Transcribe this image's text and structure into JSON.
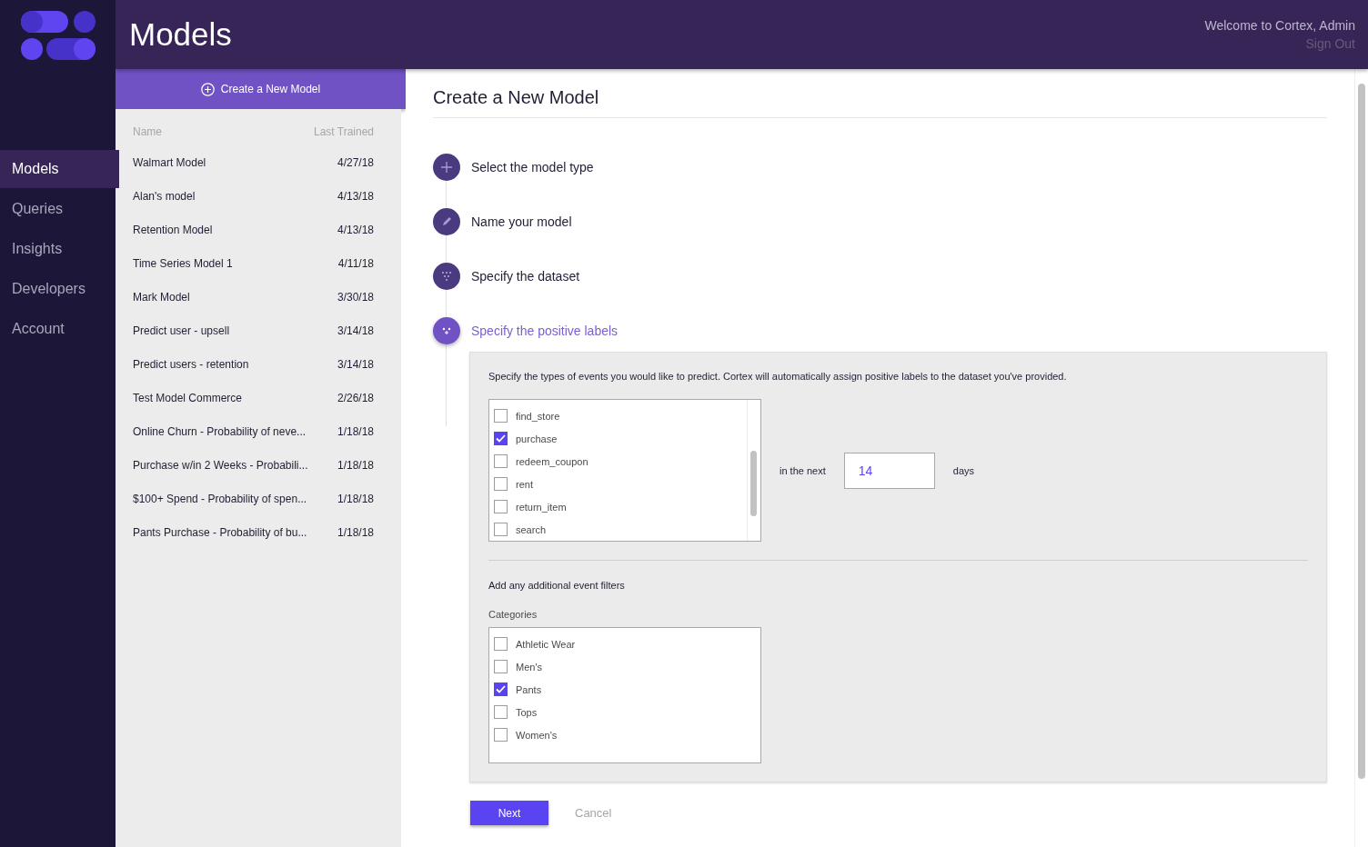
{
  "header": {
    "title": "Models",
    "welcome": "Welcome to Cortex, Admin",
    "sign_out": "Sign Out"
  },
  "nav": [
    {
      "label": "Models",
      "selected": true
    },
    {
      "label": "Queries",
      "selected": false
    },
    {
      "label": "Insights",
      "selected": false
    },
    {
      "label": "Developers",
      "selected": false
    },
    {
      "label": "Account",
      "selected": false
    }
  ],
  "model_list": {
    "create_button": "Create a New Model",
    "columns": [
      "Name",
      "Last Trained"
    ],
    "rows": [
      {
        "name": "Walmart Model",
        "last_trained": "4/27/18"
      },
      {
        "name": "Alan's model",
        "last_trained": "4/13/18"
      },
      {
        "name": "Retention Model",
        "last_trained": "4/13/18"
      },
      {
        "name": "Time Series Model 1",
        "last_trained": "4/11/18"
      },
      {
        "name": "Mark Model",
        "last_trained": "3/30/18"
      },
      {
        "name": "Predict user - upsell",
        "last_trained": "3/14/18"
      },
      {
        "name": "Predict users - retention",
        "last_trained": "3/14/18"
      },
      {
        "name": "Test Model Commerce",
        "last_trained": "2/26/18"
      },
      {
        "name": "Online Churn - Probability of neve...",
        "last_trained": "1/18/18"
      },
      {
        "name": "Purchase w/in 2 Weeks - Probabili...",
        "last_trained": "1/18/18"
      },
      {
        "name": "$100+ Spend - Probability of spen...",
        "last_trained": "1/18/18"
      },
      {
        "name": "Pants Purchase - Probability of bu...",
        "last_trained": "1/18/18"
      }
    ]
  },
  "form": {
    "title": "Create a New Model",
    "steps": [
      {
        "kind": "plus",
        "label": "Select the model type",
        "selected": false
      },
      {
        "kind": "pencil",
        "label": "Name your model",
        "selected": false
      },
      {
        "kind": "dataset",
        "label": "Specify the dataset",
        "selected": false
      },
      {
        "kind": "labels",
        "label": "Specify the positive labels",
        "selected": true
      }
    ],
    "description": "Specify the types of events you would like to predict. Cortex will automatically assign positive labels to the dataset you've provided.",
    "events": [
      {
        "label": "find_store",
        "checked": false
      },
      {
        "label": "purchase",
        "checked": true
      },
      {
        "label": "redeem_coupon",
        "checked": false
      },
      {
        "label": "rent",
        "checked": false
      },
      {
        "label": "return_item",
        "checked": false
      },
      {
        "label": "search",
        "checked": false
      }
    ],
    "window_prefix": "in the next",
    "window_value": "14",
    "window_suffix": "days",
    "filters_heading": "Add any additional event filters",
    "categories_label": "Categories",
    "categories": [
      {
        "label": "Athletic Wear",
        "checked": false
      },
      {
        "label": "Men's",
        "checked": false
      },
      {
        "label": "Pants",
        "checked": true
      },
      {
        "label": "Tops",
        "checked": false
      },
      {
        "label": "Women's",
        "checked": false
      }
    ],
    "next": "Next",
    "cancel": "Cancel"
  }
}
